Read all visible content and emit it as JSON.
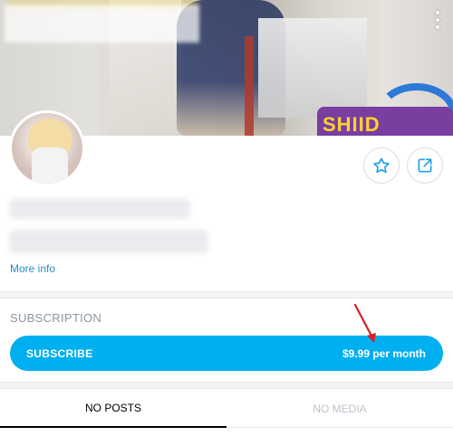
{
  "profile": {
    "more_info_label": "More info"
  },
  "subscription": {
    "section_title": "SUBSCRIPTION",
    "button_label": "SUBSCRIBE",
    "price_label": "$9.99 per month",
    "accent_color": "#00aff0"
  },
  "tabs": {
    "posts_label": "NO POSTS",
    "media_label": "NO MEDIA"
  },
  "banner": {
    "logo_text": "SHIID"
  },
  "icons": {
    "favorite": "star-icon",
    "share": "share-icon",
    "menu": "kebab-menu-icon"
  }
}
